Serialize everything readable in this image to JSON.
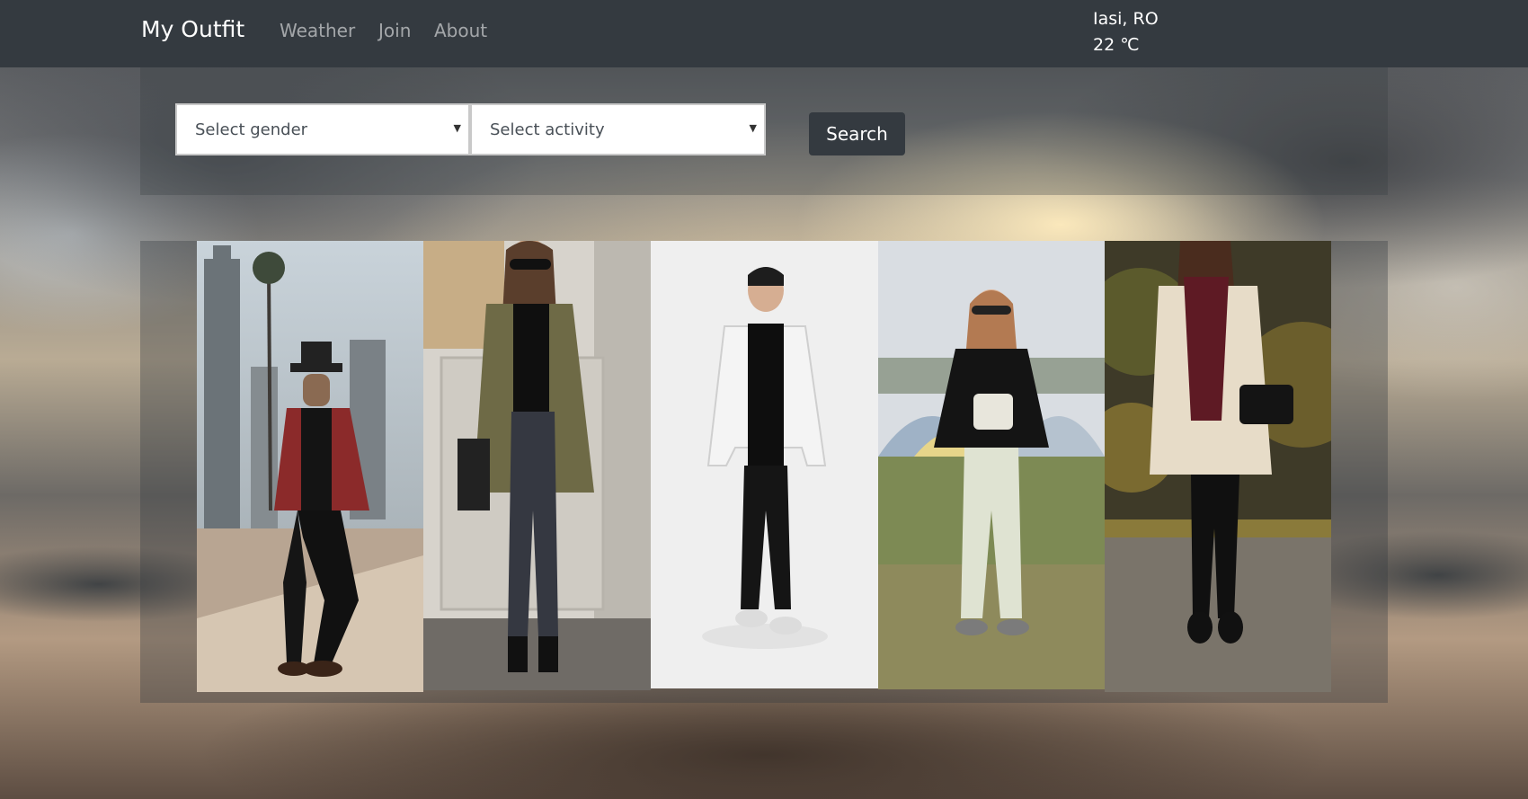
{
  "navbar": {
    "brand": "My Outfit",
    "links": [
      {
        "label": "Weather"
      },
      {
        "label": "Join"
      },
      {
        "label": "About"
      }
    ],
    "weather": {
      "location": "Iasi, RO",
      "temperature": "22 ℃"
    }
  },
  "search": {
    "gender_select": {
      "selected": "Select gender"
    },
    "activity_select": {
      "selected": "Select activity"
    },
    "button_label": "Search"
  },
  "gallery": {
    "items": [
      {
        "description": "man-hat-plaid-shirt"
      },
      {
        "description": "woman-olive-jacket"
      },
      {
        "description": "man-white-jacket"
      },
      {
        "description": "woman-black-hoodie"
      },
      {
        "description": "woman-cream-coat"
      }
    ]
  },
  "colors": {
    "navbar": "#343a40",
    "brand_text": "#ffffff",
    "nav_link": "#9a9da0",
    "button": "#343a40"
  }
}
